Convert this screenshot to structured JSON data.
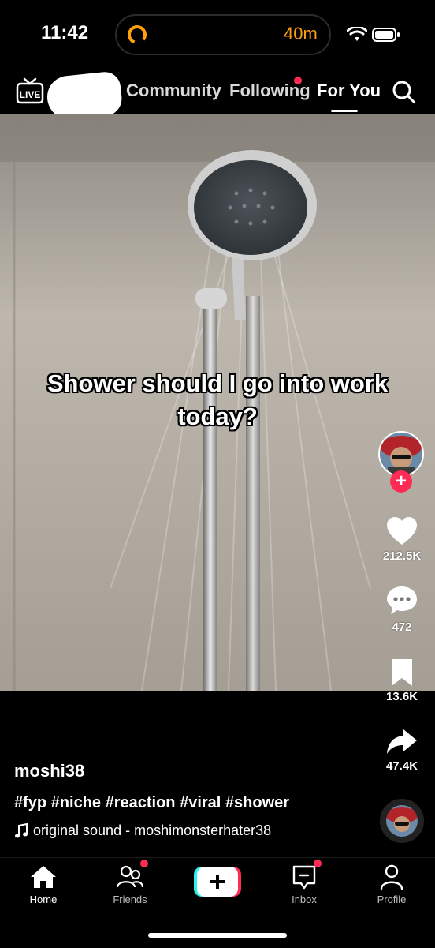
{
  "status_bar": {
    "time": "11:42",
    "activity_text": "40m",
    "activity_color": "#ff9f0a"
  },
  "top_nav": {
    "live_label": "LIVE",
    "tabs": [
      {
        "label": "Community"
      },
      {
        "label": "Following"
      },
      {
        "label": "For You",
        "active": true
      }
    ]
  },
  "video": {
    "caption": "Shower should I go into work today?"
  },
  "actions": {
    "likes": "212.5K",
    "comments": "472",
    "saves": "13.6K",
    "shares": "47.4K"
  },
  "post": {
    "username": "moshi38",
    "hashtags": "#fyp #niche #reaction #viral #shower",
    "sound": "original sound - moshimonsterhater38"
  },
  "bottom_nav": {
    "items": [
      {
        "label": "Home",
        "icon": "home-icon",
        "active": true
      },
      {
        "label": "Friends",
        "icon": "friends-icon",
        "badge": true
      },
      {
        "label": "",
        "icon": "create-icon"
      },
      {
        "label": "Inbox",
        "icon": "inbox-icon",
        "badge": true
      },
      {
        "label": "Profile",
        "icon": "profile-icon"
      }
    ]
  },
  "colors": {
    "accent": "#fe2c55",
    "cyan": "#25f4ee",
    "background": "#000000"
  }
}
